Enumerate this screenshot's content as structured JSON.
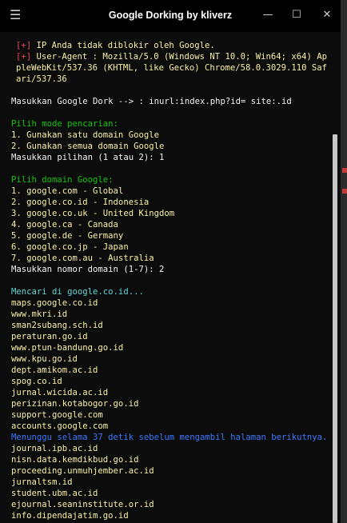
{
  "window": {
    "title": "Google Dorking by kliverz",
    "menu_icon": "hamburger-icon",
    "minimize_icon": "minimize-icon",
    "maximize_icon": "maximize-icon",
    "close_icon": "close-icon"
  },
  "colors": {
    "background": "#0c0c0c",
    "red": "#e74856",
    "green": "#16c60c",
    "yellow": "#f9f1a5",
    "cyan": "#61d6d6",
    "blue": "#3b78ff"
  },
  "terminal": {
    "status": {
      "line1_prefix": "[+]",
      "line1_text": " IP Anda tidak diblokir oleh Google.",
      "line2_prefix": "[+]",
      "line2_text": " User-Agent : Mozilla/5.0 (Windows NT 10.0; Win64; x64) AppleWebKit/537.36 (KHTML, like Gecko) Chrome/58.0.3029.110 Safari/537.36"
    },
    "dork_prompt": "Masukkan Google Dork --> : inurl:index.php?id= site:.id",
    "mode": {
      "header": "Pilih mode pencarian:",
      "option1": "1. Gunakan satu domain Google",
      "option2": "2. Gunakan semua domain Google",
      "prompt": "Masukkan pilihan (1 atau 2): 1"
    },
    "domains": {
      "header": "Pilih domain Google:",
      "items": [
        "1. google.com - Global",
        "2. google.co.id - Indonesia",
        "3. google.co.uk - United Kingdom",
        "4. google.ca - Canada",
        "5. google.de - Germany",
        "6. google.co.jp - Japan",
        "7. google.com.au - Australia"
      ],
      "prompt": "Masukkan nomor domain (1-7): 2"
    },
    "search": {
      "searching": "Mencari di google.co.id...",
      "results_a": [
        "maps.google.co.id",
        "www.mkri.id",
        "sman2subang.sch.id",
        "peraturan.go.id",
        "www.ptun-bandung.go.id",
        "www.kpu.go.id",
        "dept.amikom.ac.id",
        "spog.co.id",
        "jurnal.wicida.ac.id",
        "perizinan.kotabogor.go.id",
        "support.google.com",
        "accounts.google.com"
      ],
      "waiting": "Menunggu selama 37 detik sebelum mengambil halaman berikutnya...",
      "results_b": [
        "journal.ipb.ac.id",
        "nisn.data.kemdikbud.go.id",
        "proceeding.unmuhjember.ac.id",
        "jurnaltsm.id",
        "student.ubm.ac.id",
        "ejournal.seaninstitute.or.id",
        "info.dipendajatim.go.id"
      ]
    }
  }
}
